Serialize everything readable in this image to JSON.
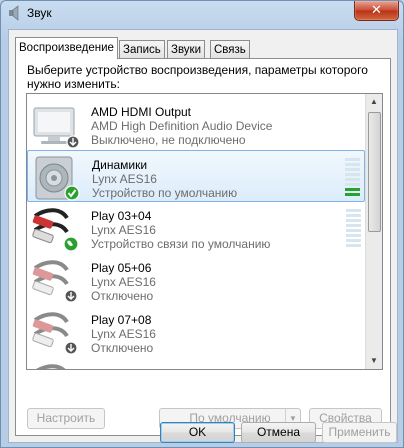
{
  "window": {
    "title": "Звук",
    "close_label": "✕"
  },
  "tabs": [
    {
      "label": "Воспроизведение"
    },
    {
      "label": "Запись"
    },
    {
      "label": "Звуки"
    },
    {
      "label": "Связь"
    }
  ],
  "instruction": "Выберите устройство воспроизведения, параметры которого нужно изменить:",
  "devices": [
    {
      "name": "AMD HDMI Output",
      "description": "AMD High Definition Audio Device",
      "status": "Выключено, не подключено",
      "icon": "monitor-icon"
    },
    {
      "name": "Динамики",
      "description": "Lynx AES16",
      "status": "Устройство по умолчанию",
      "icon": "speaker-icon",
      "meter_level": 0.25
    },
    {
      "name": "Play 03+04",
      "description": "Lynx AES16",
      "status": "Устройство связи по умолчанию",
      "icon": "rca-cable-icon",
      "meter_level": 0
    },
    {
      "name": "Play 05+06",
      "description": "Lynx AES16",
      "status": "Отключено",
      "icon": "rca-cable-icon"
    },
    {
      "name": "Play 07+08",
      "description": "Lynx AES16",
      "status": "Отключено",
      "icon": "rca-cable-icon"
    }
  ],
  "buttons": {
    "configure": "Настроить",
    "set_default": "По умолчанию",
    "properties": "Свойства",
    "ok": "OK",
    "cancel": "Отмена",
    "apply": "Применить"
  },
  "colors": {
    "selection": "#dcecfb",
    "meter_on": "#2aa12e",
    "default_check": "#2aa12e"
  }
}
